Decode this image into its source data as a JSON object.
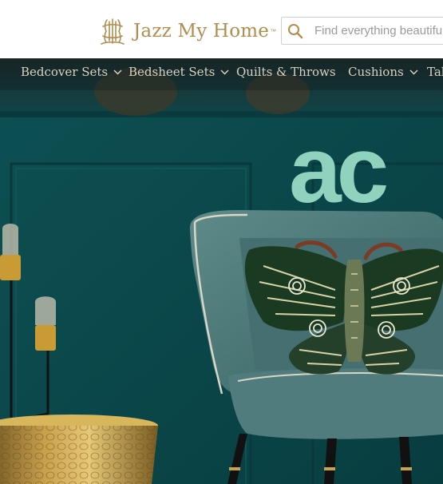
{
  "brand": {
    "name": "Jazz My Home",
    "trademark": "™",
    "logo_icon": "monogram-logo-icon",
    "color": "#b08d4e"
  },
  "search": {
    "placeholder": "Find everything beautiful",
    "icon": "search-icon"
  },
  "nav": {
    "items": [
      {
        "label": "Bedcover Sets",
        "has_dropdown": true
      },
      {
        "label": "Bedsheet Sets",
        "has_dropdown": true
      },
      {
        "label": "Quilts & Throws",
        "has_dropdown": false
      },
      {
        "label": "Cushions",
        "has_dropdown": true
      },
      {
        "label": "Tab",
        "has_dropdown": false
      }
    ]
  },
  "hero": {
    "headline_fragment": "ac",
    "headline_color": "#8fd3be",
    "wall_color": "#0b4548"
  }
}
